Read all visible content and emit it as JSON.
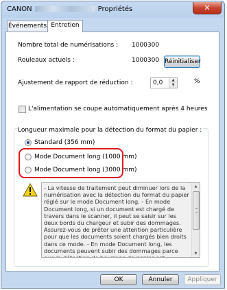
{
  "window": {
    "title_prefix": "CANON",
    "title_suffix": "Propriétés",
    "close_label": "✕"
  },
  "tabs": [
    {
      "label": "Événements",
      "active": false
    },
    {
      "label": "Entretien",
      "active": true
    }
  ],
  "stats": {
    "total_scans_label": "Nombre total de numérisations :",
    "total_scans_value": "1000300",
    "rollers_label": "Rouleaux actuels :",
    "rollers_value": "1000300",
    "reset_button": "Réinitialiser"
  },
  "reduction": {
    "label": "Ajustement de rapport de réduction :",
    "value": "0,0",
    "unit": "%"
  },
  "power_off": {
    "label": "L'alimentation se coupe automatiquement après 4 heures",
    "checked": false
  },
  "paper_detection": {
    "group_label": "Longueur maximale pour la détection du format du papier :",
    "options": [
      {
        "label": "Standard (356 mm)",
        "checked": true
      },
      {
        "label": "Mode Document long (1000 mm)",
        "checked": false
      },
      {
        "label": "Mode Document long (3000 mm)",
        "checked": false
      }
    ]
  },
  "warning": {
    "icon": "warning-icon",
    "text": "- La vitesse de traitement peut diminuer lors de la numérisation avec la détection du format du papier réglé sur le mode Document long. - En mode Document long, si un document est chargé de travers dans le scanner, il peut se saisir sur les deux bords du chargeur et subir des dommages. Assurez-vous de prêter une attention particulière pour que les documents soient chargés bien droits dans ce mode. - En mode Document long, les documents peuvent subir des dommages parce que la détection de bourrage de papier est retardée. Assurez-vous de prêter une attention"
  },
  "footer": {
    "ok": "OK",
    "cancel": "Annuler",
    "apply": "Appliquer"
  },
  "colors": {
    "highlight_border": "#e0161e",
    "close_button": "#c7452f",
    "radio_selected": "#1f4a8a"
  }
}
